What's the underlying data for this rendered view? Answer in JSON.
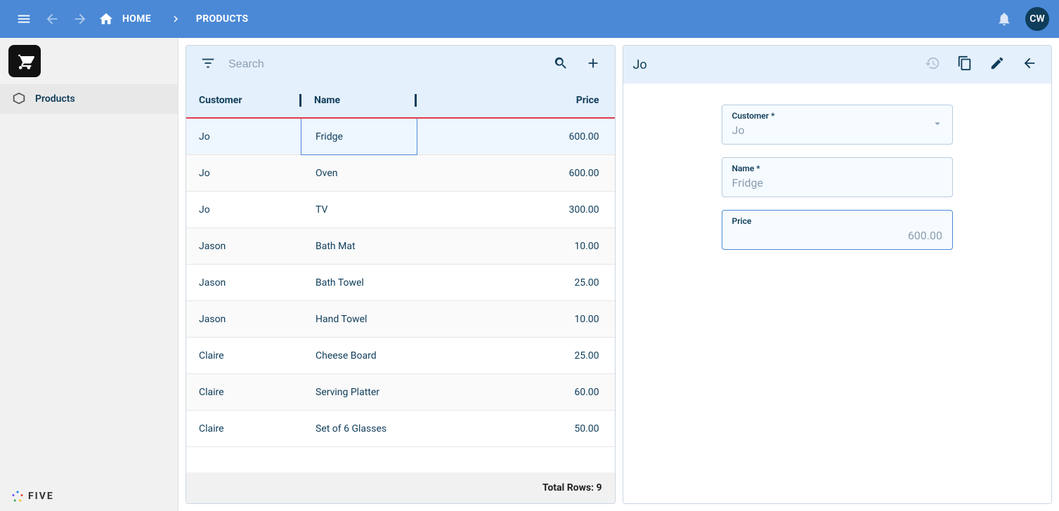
{
  "header": {
    "home_label": "HOME",
    "products_label": "PRODUCTS",
    "avatar_initials": "CW"
  },
  "sidebar": {
    "products_label": "Products",
    "brand": "FIVE"
  },
  "listPanel": {
    "search_placeholder": "Search",
    "columns": {
      "customer": "Customer",
      "name": "Name",
      "price": "Price"
    },
    "rows": [
      {
        "customer": "Jo",
        "name": "Fridge",
        "price": "600.00",
        "selected": true
      },
      {
        "customer": "Jo",
        "name": "Oven",
        "price": "600.00"
      },
      {
        "customer": "Jo",
        "name": "TV",
        "price": "300.00"
      },
      {
        "customer": "Jason",
        "name": "Bath Mat",
        "price": "10.00"
      },
      {
        "customer": "Jason",
        "name": "Bath Towel",
        "price": "25.00"
      },
      {
        "customer": "Jason",
        "name": "Hand Towel",
        "price": "10.00"
      },
      {
        "customer": "Claire",
        "name": "Cheese Board",
        "price": "25.00"
      },
      {
        "customer": "Claire",
        "name": "Serving Platter",
        "price": "60.00"
      },
      {
        "customer": "Claire",
        "name": "Set of 6 Glasses",
        "price": "50.00"
      }
    ],
    "footer_label": "Total Rows: 9"
  },
  "detailPanel": {
    "title": "Jo",
    "fields": {
      "customer": {
        "label": "Customer *",
        "value": "Jo"
      },
      "name": {
        "label": "Name *",
        "value": "Fridge"
      },
      "price": {
        "label": "Price",
        "value": "600.00"
      }
    }
  }
}
